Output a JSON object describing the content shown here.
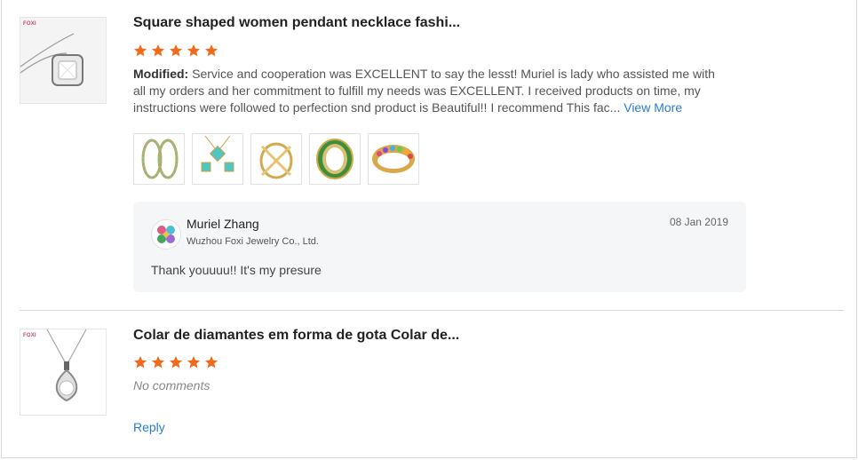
{
  "reviews": [
    {
      "brand_mark": "FOXI",
      "title": "Square shaped women pendant necklace fashi...",
      "rating": 5,
      "modified_label": "Modified:",
      "comment": "Service and cooperation was EXCELLENT to say the lesst! Muriel is lady who assisted me with all my orders and her commitment to fulfill my needs was EXCELLENT. I received products on time, my instructions were followed to perfection snd product is Beautiful!! I recommend This fac...",
      "view_more": "View More",
      "gallery": [
        "earrings",
        "jewelry-set",
        "cross-ring",
        "green-ring",
        "multicolor-ring"
      ],
      "reply": {
        "name": "Muriel Zhang",
        "company": "Wuzhou Foxi Jewelry Co., Ltd.",
        "date": "08 Jan 2019",
        "text": "Thank youuuu!! It's my presure"
      }
    },
    {
      "brand_mark": "FOXI",
      "title": "Colar de diamantes em forma de gota Colar de...",
      "rating": 5,
      "no_comments": "No comments",
      "reply_link": "Reply"
    }
  ],
  "colors": {
    "star": "#f26a1b",
    "link": "#2a7bd6"
  },
  "icons": [
    "star-icon",
    "avatar-icon"
  ]
}
